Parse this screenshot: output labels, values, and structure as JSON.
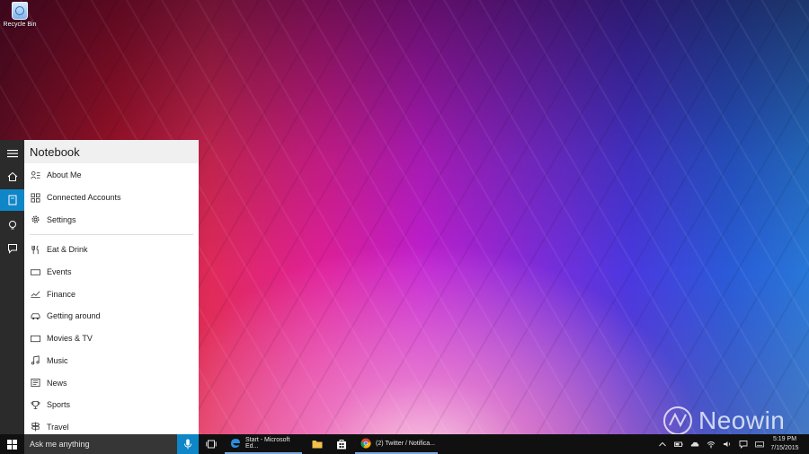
{
  "desktop": {
    "icons": [
      {
        "label": "Recycle Bin",
        "icon": "recycle-bin-icon"
      }
    ]
  },
  "cortana": {
    "rail": [
      {
        "name": "hamburger-menu-icon"
      },
      {
        "name": "home-icon"
      },
      {
        "name": "notebook-icon",
        "active": true
      },
      {
        "name": "lightbulb-icon"
      },
      {
        "name": "feedback-icon"
      }
    ],
    "notebook": {
      "title": "Notebook",
      "settings_items": [
        {
          "label": "About Me",
          "icon": "about-me-icon"
        },
        {
          "label": "Connected Accounts",
          "icon": "connected-accounts-icon"
        },
        {
          "label": "Settings",
          "icon": "gear-icon"
        }
      ],
      "interest_items": [
        {
          "label": "Eat & Drink",
          "icon": "fork-knife-icon"
        },
        {
          "label": "Events",
          "icon": "ticket-icon"
        },
        {
          "label": "Finance",
          "icon": "chart-icon"
        },
        {
          "label": "Getting around",
          "icon": "car-icon"
        },
        {
          "label": "Movies & TV",
          "icon": "tv-icon"
        },
        {
          "label": "Music",
          "icon": "music-note-icon"
        },
        {
          "label": "News",
          "icon": "newspaper-icon"
        },
        {
          "label": "Sports",
          "icon": "trophy-icon"
        },
        {
          "label": "Travel",
          "icon": "signpost-icon"
        }
      ]
    }
  },
  "taskbar": {
    "search_placeholder": "Ask me anything",
    "apps": [
      {
        "label": "Start - Microsoft Ed...",
        "icon": "edge-icon"
      },
      {
        "label": "(2) Twitter / Notifica...",
        "icon": "chrome-icon"
      }
    ],
    "pinned": [
      {
        "name": "file-explorer-icon"
      },
      {
        "name": "store-icon"
      }
    ],
    "tray": [
      {
        "name": "chevron-up-icon"
      },
      {
        "name": "battery-icon"
      },
      {
        "name": "onedrive-icon"
      },
      {
        "name": "wifi-icon"
      },
      {
        "name": "volume-icon"
      },
      {
        "name": "action-center-icon"
      },
      {
        "name": "keyboard-icon"
      }
    ],
    "time": "5:19 PM",
    "date": "7/15/2015"
  },
  "watermark": {
    "text": "Neowin"
  },
  "colors": {
    "accent": "#0f86c8",
    "rail_bg": "#2b2b2b",
    "taskbar_bg": "#101010",
    "search_bg": "#363636"
  }
}
